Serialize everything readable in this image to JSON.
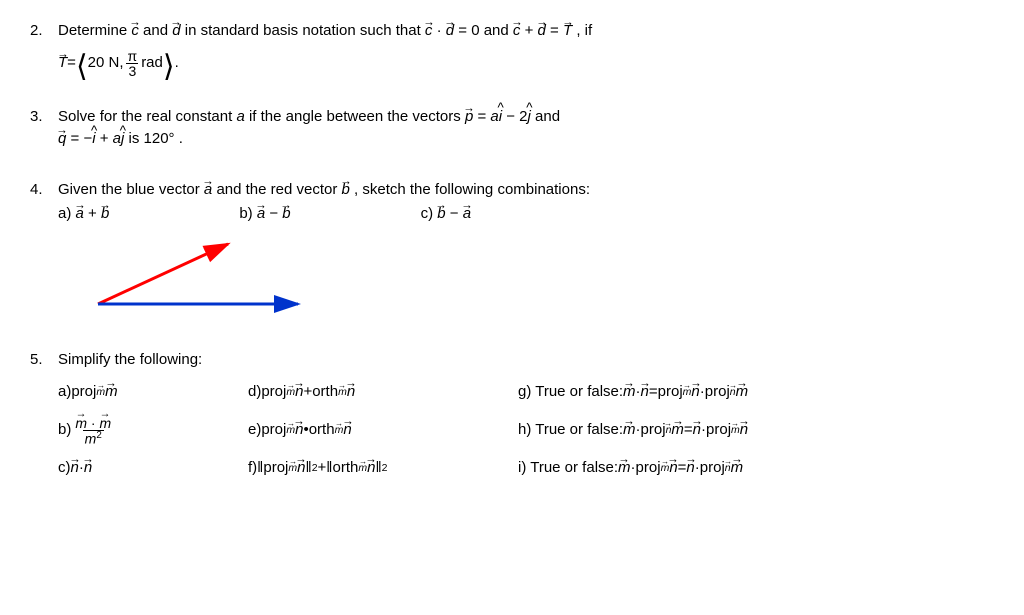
{
  "q2": {
    "num": "2.",
    "text_a": "Determine ",
    "c": "c",
    "text_b": " and ",
    "d": "d",
    "text_c": " in standard basis notation such that ",
    "eq1_l": "c",
    "eq1_dot": " · ",
    "eq1_r": "d",
    "eq1_rhs": " = 0",
    "text_d": " and ",
    "eq2_l": "c",
    "eq2_plus": " + ",
    "eq2_r": "d",
    "eq2_T": "T",
    "eq2_eq": " = ",
    "text_e": " , if",
    "line2_T": "T",
    "line2_eq": " = ",
    "line2_val": "20 N, ",
    "line2_pi": "π",
    "line2_den": "3",
    "line2_rad": " rad",
    "line2_dot": " ."
  },
  "q3": {
    "num": "3.",
    "text_a": "Solve for the real constant ",
    "a": "a",
    "text_b": " if the angle between the vectors ",
    "p": "p",
    "eq": " = ",
    "a2": "a",
    "i": "i",
    "minus": " − 2",
    "j": "j",
    "text_c": " and",
    "q": "q",
    "eq2": " = −",
    "i2": "i",
    "plus": " + ",
    "a3": "a",
    "j2": "j",
    "text_d": " is 120° ."
  },
  "q4": {
    "num": "4.",
    "text_a": "Given the blue vector ",
    "a": "a",
    "text_b": " and the red vector ",
    "b": "b",
    "text_c": " , sketch the following combinations:",
    "pa_lbl": "a) ",
    "pa_a": "a",
    "pa_op": " + ",
    "pa_b": "b",
    "pb_lbl": "b) ",
    "pb_a": "a",
    "pb_op": " − ",
    "pb_b": "b",
    "pc_lbl": "c) ",
    "pc_a": "b",
    "pc_op": " − ",
    "pc_b": "a"
  },
  "q5": {
    "num": "5.",
    "text": "Simplify the following:",
    "a_lbl": "a)  ",
    "a_proj": "proj",
    "a_m1": "m",
    "a_m2": "m",
    "b_lbl": "b)  ",
    "b_m1": "m",
    "b_dot": " · ",
    "b_m2": "m",
    "b_den": "m",
    "b_exp": "2",
    "c_lbl": "c)  ",
    "c_n1": "n",
    "c_dot": " · ",
    "c_n2": "n",
    "d_lbl": "d) ",
    "d_proj": "proj",
    "d_m": "m",
    "d_n1": "n",
    "d_plus": " + ",
    "d_orth": "orth",
    "d_m2": "m",
    "d_n2": "n",
    "e_lbl": "e) ",
    "e_proj": "proj",
    "e_m": "m",
    "e_n1": "n",
    "e_dot": " • ",
    "e_orth": "orth",
    "e_m2": "m",
    "e_n2": "n",
    "f_lbl": "f) ",
    "f_proj": "proj",
    "f_m": "m",
    "f_n1": "n",
    "f_exp1": "2",
    "f_plus": " + ",
    "f_orth": "orth",
    "f_m2": "m",
    "f_n2": "n",
    "f_exp2": "2",
    "g_lbl": "g) True or false: ",
    "g_m": "m",
    "g_dot": " · ",
    "g_n": "n",
    "g_eq": " = ",
    "g_proj1": "proj",
    "g_sub1": "m",
    "g_arg1": "n",
    "g_dot2": " · ",
    "g_proj2": "proj",
    "g_sub2": "n",
    "g_arg2": "m",
    "h_lbl": "h) True or false: ",
    "h_m": "m",
    "h_dot": " · ",
    "h_proj1": "proj",
    "h_sub1": "n",
    "h_arg1": "m",
    "h_eq": " = ",
    "h_n": "n",
    "h_dot2": " · ",
    "h_proj2": "proj",
    "h_sub2": "m",
    "h_arg2": "n",
    "i_lbl": "i) True or false: ",
    "i_m": "m",
    "i_dot": " · ",
    "i_proj1": "proj",
    "i_sub1": "m",
    "i_arg1": "n",
    "i_eq": " = ",
    "i_n": "n",
    "i_dot2": " · ",
    "i_proj2": "proj",
    "i_sub2": "n",
    "i_arg2": "m"
  }
}
